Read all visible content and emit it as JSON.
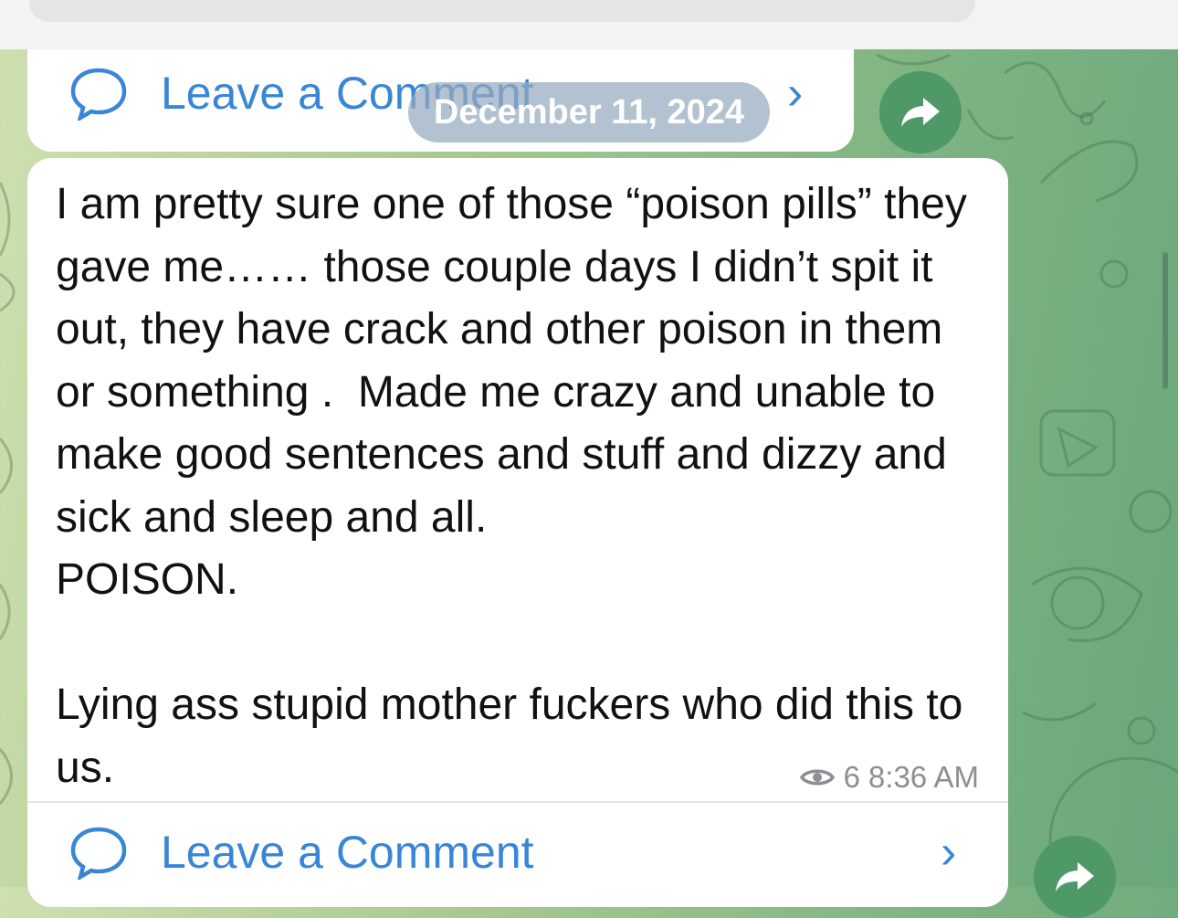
{
  "header": {
    "date_separator": "December 11, 2024"
  },
  "previous_post": {
    "comment_label": "Leave a Comment"
  },
  "message": {
    "text": "I am pretty sure one of those “poison pills” they gave me…… those couple days I didn’t spit it out, they have crack and other poison in them or something .  Made me crazy and unable to make good sentences and stuff and dizzy and sick and sleep and all.\nPOISON.\n\nLying ass stupid mother fuckers who did this to us.",
    "views": "6",
    "time": "8:36 AM",
    "comment_label": "Leave a Comment"
  },
  "icons": {
    "comment": "comment-bubble-icon",
    "chevron": "chevron-right-icon",
    "views": "eye-icon",
    "forward": "forward-arrow-icon"
  },
  "colors": {
    "accent": "#3a86d6",
    "forward_button": "#4f9868",
    "meta_text": "#8e8e93"
  }
}
